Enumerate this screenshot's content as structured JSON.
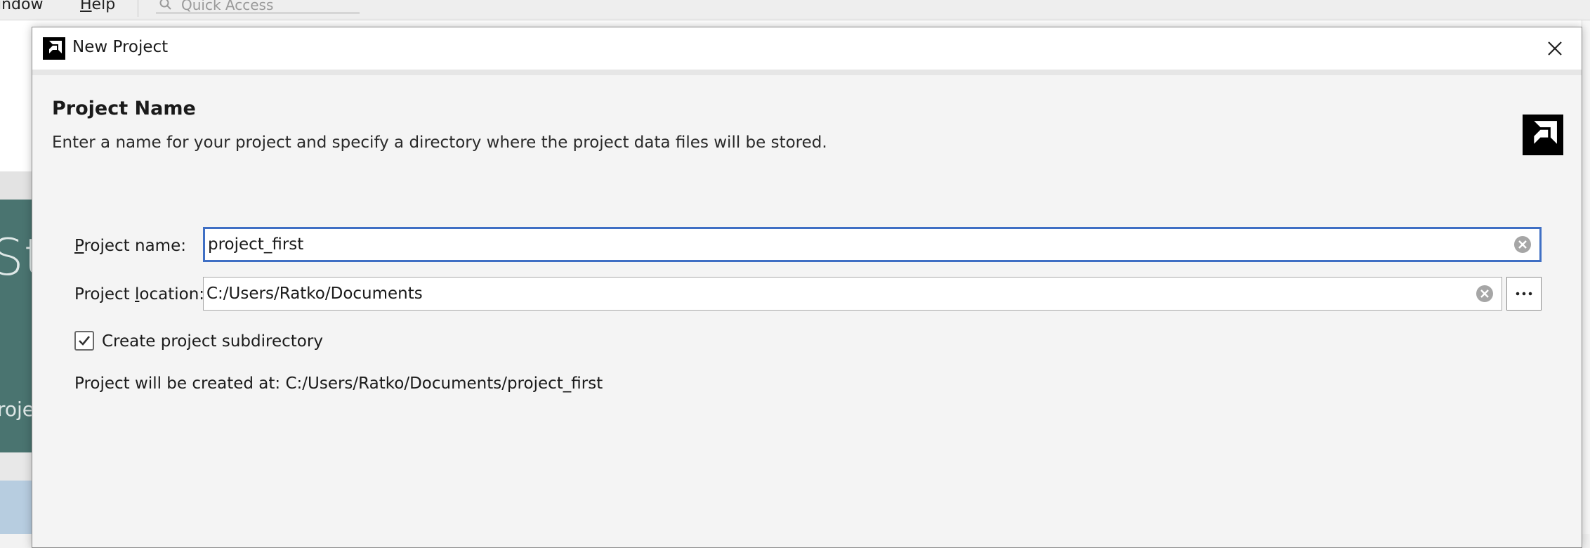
{
  "background_app": {
    "menu": {
      "window_label": "indow",
      "help_label_mnemonic": "H",
      "help_label_rest": "elp"
    },
    "quick_access_placeholder": "Quick Access",
    "welcome_title_fragment": "St",
    "welcome_subtitle_fragment": "roje"
  },
  "dialog": {
    "title": "New Project",
    "header": {
      "title": "Project Name",
      "description": "Enter a name for your project and specify a directory where the project data files will be stored."
    },
    "project_name": {
      "label_mnemonic": "P",
      "label_rest": "roject name:",
      "value": "project_first"
    },
    "project_location": {
      "label_before": "Project ",
      "label_mnemonic": "l",
      "label_after": "ocation:",
      "value": "C:/Users/Ratko/Documents",
      "browse_label": "⋯"
    },
    "create_subdirectory": {
      "label": "Create project subdirectory",
      "checked": true
    },
    "result_text": "Project will be created at: C:/Users/Ratko/Documents/project_first"
  },
  "colors": {
    "focus_border": "#3f6fc4",
    "welcome_panel": "#4a7470",
    "dialog_background": "#f4f4f4"
  },
  "icons": {
    "app": "amd-logo-icon",
    "close": "close-icon",
    "clear": "clear-circle-icon",
    "check": "checkmark-icon",
    "search": "search-icon"
  }
}
